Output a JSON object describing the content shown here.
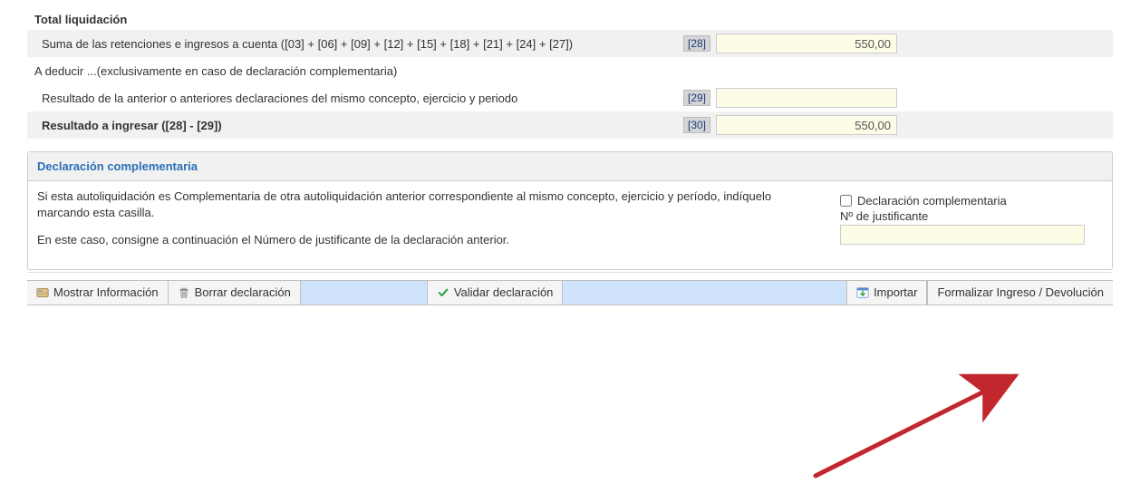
{
  "total_liquidacion": {
    "title": "Total liquidación",
    "row28": {
      "label": "Suma de las retenciones e ingresos a cuenta ([03] + [06] + [09] + [12] + [15] + [18] + [21] + [24] + [27])",
      "tag": "[28]",
      "value": "550,00"
    },
    "a_deducir_label": "A deducir ...(exclusivamente en caso de declaración complementaria)",
    "row29": {
      "label": "Resultado de la anterior o anteriores declaraciones del mismo concepto, ejercicio y periodo",
      "tag": "[29]",
      "value": ""
    },
    "row30": {
      "label": "Resultado a ingresar ([28] - [29])",
      "tag": "[30]",
      "value": "550,00"
    }
  },
  "complementaria": {
    "header": "Declaración complementaria",
    "text1": "Si esta autoliquidación es Complementaria de otra autoliquidación anterior correspondiente al mismo concepto, ejercicio y período, indíquelo marcando esta casilla.",
    "text2": "En este caso, consigne a continuación el Número de justificante de la declaración anterior.",
    "checkbox_label": "Declaración complementaria",
    "justificante_label": "Nº de justificante",
    "justificante_value": ""
  },
  "toolbar": {
    "mostrar_info": "Mostrar Información",
    "borrar": "Borrar declaración",
    "validar": "Validar declaración",
    "importar": "Importar",
    "formalizar": "Formalizar Ingreso / Devolución"
  }
}
